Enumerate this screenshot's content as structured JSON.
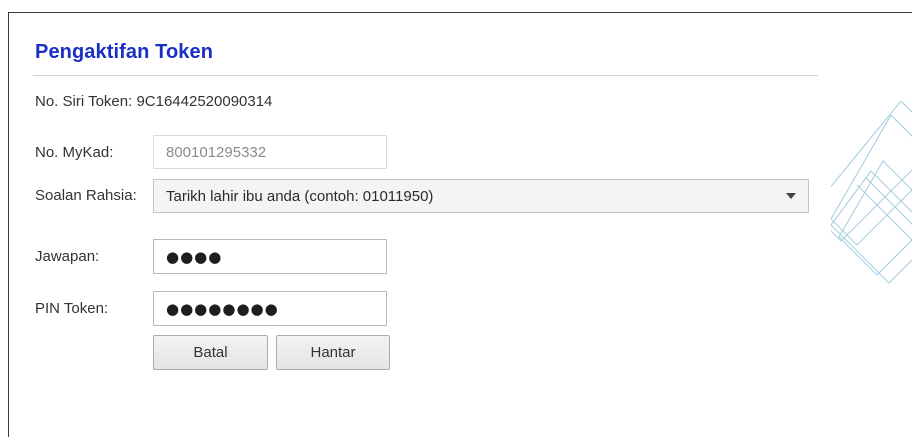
{
  "page": {
    "title": "Pengaktifan Token"
  },
  "token": {
    "serial_label": "No. Siri Token:",
    "serial_value": "9C16442520090314"
  },
  "form": {
    "mykad_label": "No. MyKad:",
    "mykad_placeholder": "800101295332",
    "question_label": "Soalan Rahsia:",
    "question_selected": "Tarikh lahir ibu anda (contoh: 01011950)",
    "answer_label": "Jawapan:",
    "answer_masked": "●●●●",
    "pin_label": "PIN Token:",
    "pin_masked": "●●●●●●●●"
  },
  "buttons": {
    "cancel_label": "Batal",
    "submit_label": "Hantar"
  },
  "icons": {
    "select_caret": "chevron-down-icon",
    "decoration": "diamond-lines-decoration"
  },
  "colors": {
    "title": "#1a2fc4",
    "decoration": "#a9cfe0"
  }
}
